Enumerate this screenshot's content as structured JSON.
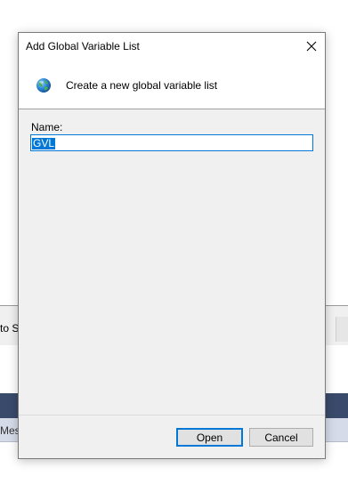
{
  "background": {
    "pane_text": "to St",
    "tab_text": "Mess"
  },
  "dialog": {
    "title": "Add Global Variable List",
    "header_text": "Create a new global variable list",
    "icon": "globe-icon",
    "name_label": "Name:",
    "name_value": "GVL",
    "open_label": "Open",
    "cancel_label": "Cancel"
  },
  "colors": {
    "accent": "#0078d7",
    "dialog_bg": "#f0f0f0",
    "button_bg": "#e1e1e1"
  }
}
